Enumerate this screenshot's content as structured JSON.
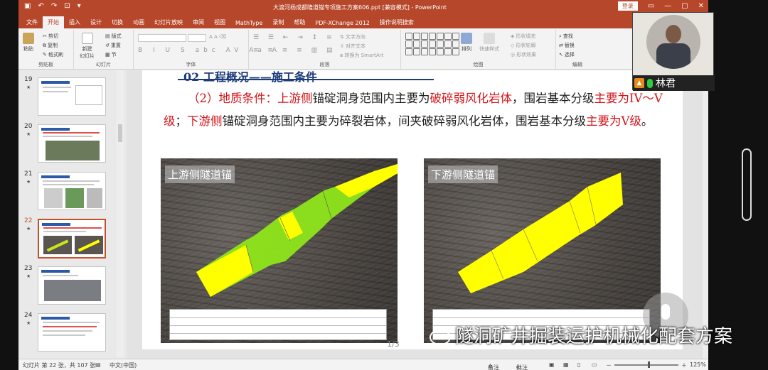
{
  "window": {
    "title": "大渡河杨成都隆道锚专项施工方案606.ppt [兼容模式] - PowerPoint",
    "signin": "登录"
  },
  "tabs": [
    "文件",
    "开始",
    "插入",
    "设计",
    "切换",
    "动画",
    "幻灯片放映",
    "审阅",
    "视图",
    "MathType",
    "录制",
    "帮助",
    "PDF-XChange 2012",
    "操作说明搜索"
  ],
  "ribbon": {
    "paste": "粘贴",
    "cut": "剪切",
    "copy": "复制",
    "format_painter": "格式刷",
    "clipboard": "剪贴板",
    "new_slide": "新建\n幻灯片",
    "layout": "版式",
    "reset": "重置",
    "section": "节",
    "slides": "幻灯片",
    "font": "字体",
    "paragraph": "段落",
    "text_direction": "文字方向",
    "align_text": "对齐文本",
    "convert_smartart": "转换为 SmartArt",
    "arrange": "排列",
    "quick_styles": "快速样式",
    "shape_fill": "形状填充",
    "shape_outline": "形状轮廓",
    "shape_effects": "形状效果",
    "drawing": "绘图",
    "find": "查找",
    "replace": "替换",
    "select": "选择",
    "editing": "编辑"
  },
  "thumbnails": [
    {
      "num": "19",
      "star": "★"
    },
    {
      "num": "20",
      "star": "★"
    },
    {
      "num": "21",
      "star": "★"
    },
    {
      "num": "22",
      "star": "★"
    },
    {
      "num": "23",
      "star": "★"
    },
    {
      "num": "24",
      "star": "★"
    }
  ],
  "slide": {
    "title": "02  工程概况——施工条件",
    "para_prefix": "（2）地质条件：",
    "up_side": "上游侧",
    "mid1": "锚碇洞身范围内主要为",
    "broken_weathered": "破碎弱风化岩体",
    "mid2": "，围岩基本分级",
    "mainly_4_5": "主要为IV～V级",
    "semicolon": "；",
    "down_side": "下游侧",
    "mid3": "锚碇洞身范围内主要为碎裂岩体，间夹破碎弱风化岩体，围岩基本分级",
    "mainly_5": "主要为V级",
    "end": "。",
    "photo_left_label": "上游侧隧道锚",
    "photo_right_label": "下游侧隧道锚"
  },
  "page_indicator": "1/3",
  "status": {
    "slide_info": "幻灯片 第 22 张，共 107 张",
    "language": "中文(中国)",
    "notes": "备注",
    "comments": "批注",
    "zoom": "125%"
  },
  "video": {
    "name": "林君"
  },
  "watermark": "隧洞矿井掘装运护机械化配套方案",
  "colors": {
    "accent": "#b7472a",
    "highlight_red": "#d4141a",
    "anchor_yellow": "#ffff00",
    "anchor_green": "#8ee61a"
  }
}
